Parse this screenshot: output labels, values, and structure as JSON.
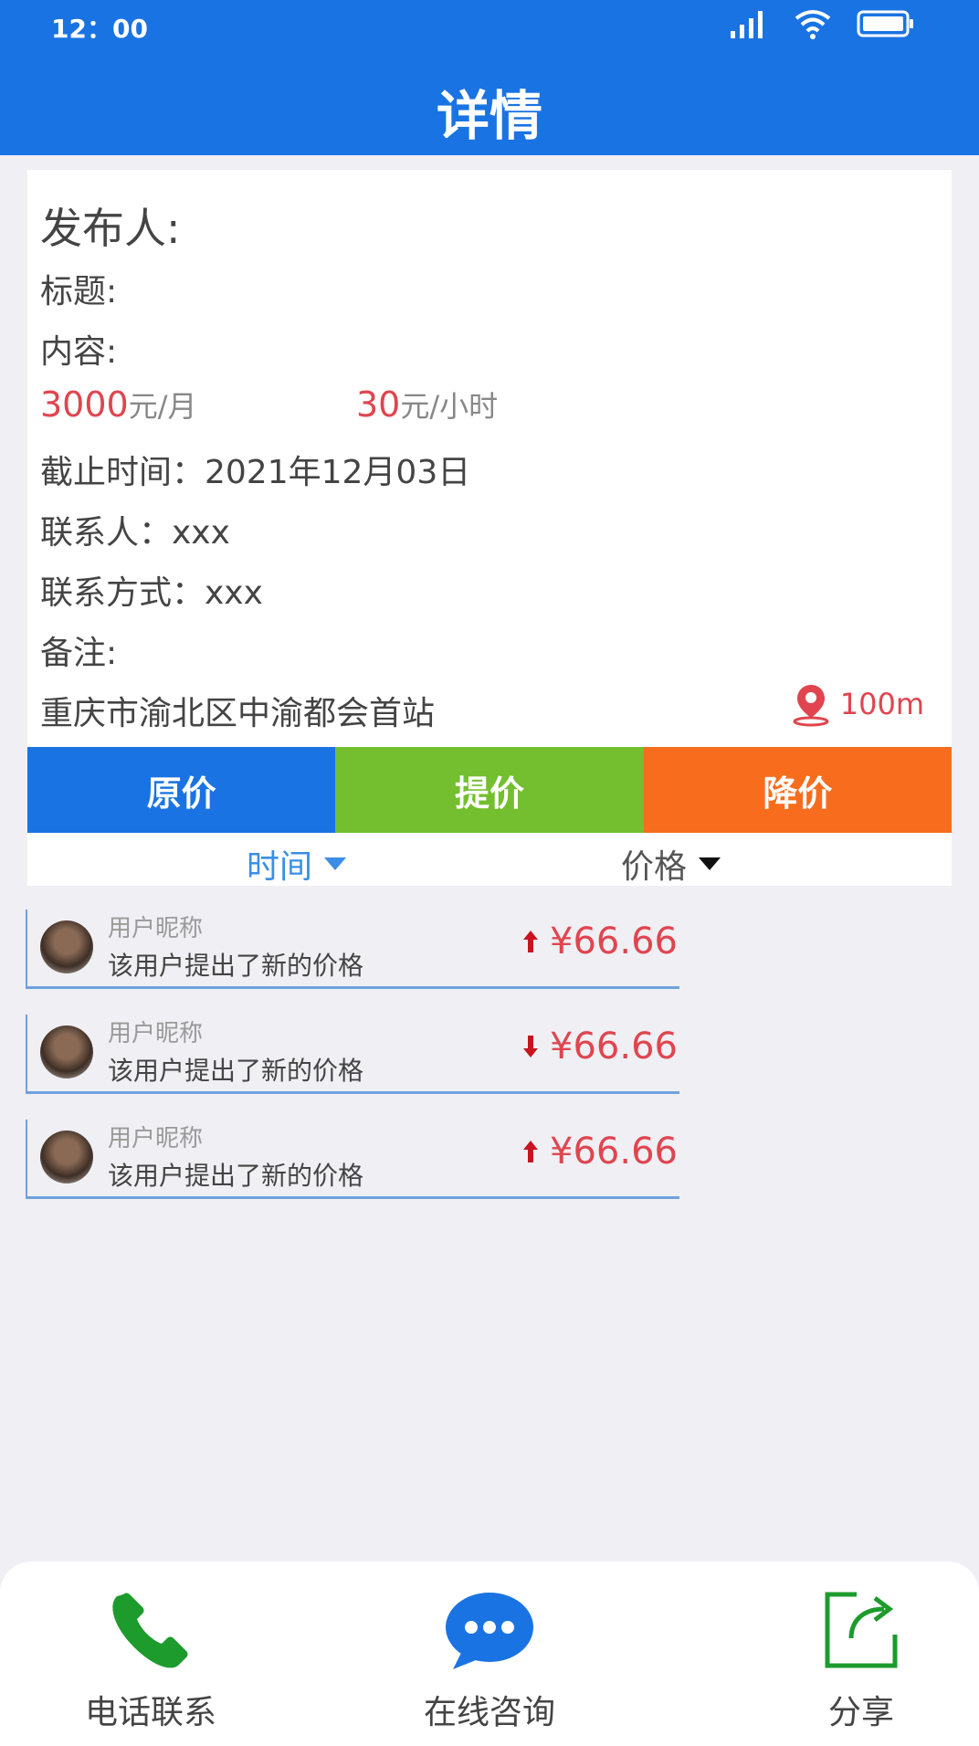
{
  "status": {
    "time": "12：00"
  },
  "header": {
    "title": "详情"
  },
  "detail": {
    "publisher_label": "发布人:",
    "title_label": "标题:",
    "content_label": "内容:",
    "price_monthly_amount": "3000",
    "price_monthly_unit": "元/月",
    "price_hourly_amount": "30",
    "price_hourly_unit": "元/小时",
    "deadline": "截止时间：2021年12月03日",
    "contact_person": "联系人：xxx",
    "contact_method": "联系方式：xxx",
    "remark_label": "备注:",
    "address": "重庆市渝北区中渝都会首站",
    "distance": "100m"
  },
  "tabs": [
    "原价",
    "提价",
    "降价"
  ],
  "sort": {
    "time": "时间",
    "price": "价格"
  },
  "bids": [
    {
      "name": "用户昵称",
      "message": "该用户提出了新的价格",
      "price": "¥66.66",
      "direction": "up"
    },
    {
      "name": "用户昵称",
      "message": "该用户提出了新的价格",
      "price": "¥66.66",
      "direction": "down"
    },
    {
      "name": "用户昵称",
      "message": "该用户提出了新的价格",
      "price": "¥66.66",
      "direction": "up"
    }
  ],
  "actions": {
    "phone": "电话联系",
    "chat": "在线咨询",
    "share": "分享"
  },
  "colors": {
    "primary": "#1a73e3",
    "green": "#73bf2f",
    "orange": "#f86d1d",
    "price_red": "#e0454f",
    "icon_green": "#1d9b2c"
  }
}
